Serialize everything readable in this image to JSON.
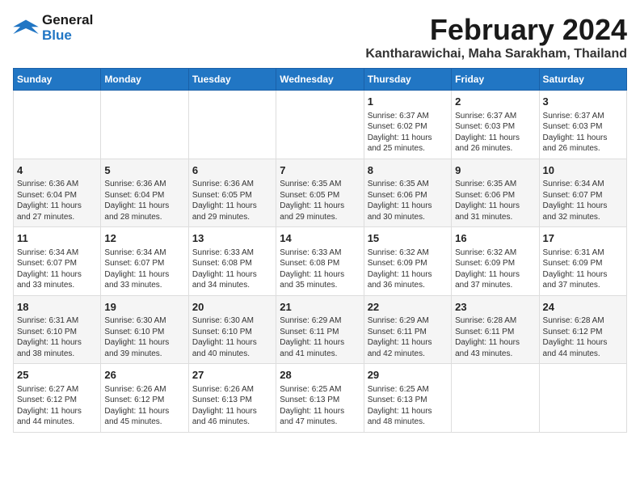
{
  "logo": {
    "line1": "General",
    "line2": "Blue"
  },
  "title": "February 2024",
  "subtitle": "Kantharawichai, Maha Sarakham, Thailand",
  "weekdays": [
    "Sunday",
    "Monday",
    "Tuesday",
    "Wednesday",
    "Thursday",
    "Friday",
    "Saturday"
  ],
  "rows": [
    [
      {
        "day": "",
        "content": ""
      },
      {
        "day": "",
        "content": ""
      },
      {
        "day": "",
        "content": ""
      },
      {
        "day": "",
        "content": ""
      },
      {
        "day": "1",
        "content": "Sunrise: 6:37 AM\nSunset: 6:02 PM\nDaylight: 11 hours\nand 25 minutes."
      },
      {
        "day": "2",
        "content": "Sunrise: 6:37 AM\nSunset: 6:03 PM\nDaylight: 11 hours\nand 26 minutes."
      },
      {
        "day": "3",
        "content": "Sunrise: 6:37 AM\nSunset: 6:03 PM\nDaylight: 11 hours\nand 26 minutes."
      }
    ],
    [
      {
        "day": "4",
        "content": "Sunrise: 6:36 AM\nSunset: 6:04 PM\nDaylight: 11 hours\nand 27 minutes."
      },
      {
        "day": "5",
        "content": "Sunrise: 6:36 AM\nSunset: 6:04 PM\nDaylight: 11 hours\nand 28 minutes."
      },
      {
        "day": "6",
        "content": "Sunrise: 6:36 AM\nSunset: 6:05 PM\nDaylight: 11 hours\nand 29 minutes."
      },
      {
        "day": "7",
        "content": "Sunrise: 6:35 AM\nSunset: 6:05 PM\nDaylight: 11 hours\nand 29 minutes."
      },
      {
        "day": "8",
        "content": "Sunrise: 6:35 AM\nSunset: 6:06 PM\nDaylight: 11 hours\nand 30 minutes."
      },
      {
        "day": "9",
        "content": "Sunrise: 6:35 AM\nSunset: 6:06 PM\nDaylight: 11 hours\nand 31 minutes."
      },
      {
        "day": "10",
        "content": "Sunrise: 6:34 AM\nSunset: 6:07 PM\nDaylight: 11 hours\nand 32 minutes."
      }
    ],
    [
      {
        "day": "11",
        "content": "Sunrise: 6:34 AM\nSunset: 6:07 PM\nDaylight: 11 hours\nand 33 minutes."
      },
      {
        "day": "12",
        "content": "Sunrise: 6:34 AM\nSunset: 6:07 PM\nDaylight: 11 hours\nand 33 minutes."
      },
      {
        "day": "13",
        "content": "Sunrise: 6:33 AM\nSunset: 6:08 PM\nDaylight: 11 hours\nand 34 minutes."
      },
      {
        "day": "14",
        "content": "Sunrise: 6:33 AM\nSunset: 6:08 PM\nDaylight: 11 hours\nand 35 minutes."
      },
      {
        "day": "15",
        "content": "Sunrise: 6:32 AM\nSunset: 6:09 PM\nDaylight: 11 hours\nand 36 minutes."
      },
      {
        "day": "16",
        "content": "Sunrise: 6:32 AM\nSunset: 6:09 PM\nDaylight: 11 hours\nand 37 minutes."
      },
      {
        "day": "17",
        "content": "Sunrise: 6:31 AM\nSunset: 6:09 PM\nDaylight: 11 hours\nand 37 minutes."
      }
    ],
    [
      {
        "day": "18",
        "content": "Sunrise: 6:31 AM\nSunset: 6:10 PM\nDaylight: 11 hours\nand 38 minutes."
      },
      {
        "day": "19",
        "content": "Sunrise: 6:30 AM\nSunset: 6:10 PM\nDaylight: 11 hours\nand 39 minutes."
      },
      {
        "day": "20",
        "content": "Sunrise: 6:30 AM\nSunset: 6:10 PM\nDaylight: 11 hours\nand 40 minutes."
      },
      {
        "day": "21",
        "content": "Sunrise: 6:29 AM\nSunset: 6:11 PM\nDaylight: 11 hours\nand 41 minutes."
      },
      {
        "day": "22",
        "content": "Sunrise: 6:29 AM\nSunset: 6:11 PM\nDaylight: 11 hours\nand 42 minutes."
      },
      {
        "day": "23",
        "content": "Sunrise: 6:28 AM\nSunset: 6:11 PM\nDaylight: 11 hours\nand 43 minutes."
      },
      {
        "day": "24",
        "content": "Sunrise: 6:28 AM\nSunset: 6:12 PM\nDaylight: 11 hours\nand 44 minutes."
      }
    ],
    [
      {
        "day": "25",
        "content": "Sunrise: 6:27 AM\nSunset: 6:12 PM\nDaylight: 11 hours\nand 44 minutes."
      },
      {
        "day": "26",
        "content": "Sunrise: 6:26 AM\nSunset: 6:12 PM\nDaylight: 11 hours\nand 45 minutes."
      },
      {
        "day": "27",
        "content": "Sunrise: 6:26 AM\nSunset: 6:13 PM\nDaylight: 11 hours\nand 46 minutes."
      },
      {
        "day": "28",
        "content": "Sunrise: 6:25 AM\nSunset: 6:13 PM\nDaylight: 11 hours\nand 47 minutes."
      },
      {
        "day": "29",
        "content": "Sunrise: 6:25 AM\nSunset: 6:13 PM\nDaylight: 11 hours\nand 48 minutes."
      },
      {
        "day": "",
        "content": ""
      },
      {
        "day": "",
        "content": ""
      }
    ]
  ]
}
